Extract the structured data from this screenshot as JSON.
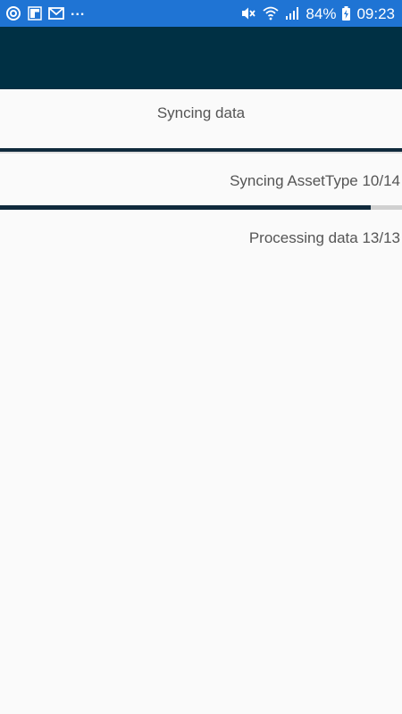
{
  "status_bar": {
    "icons_left": [
      "sync-circle-icon",
      "flipboard-icon",
      "gmail-icon"
    ],
    "more_notifications": "...",
    "icons_right": [
      "mute-icon",
      "wifi-icon",
      "signal-icon"
    ],
    "battery_percent": "84%",
    "time": "09:23",
    "background": "#1f74d4"
  },
  "app_bar": {
    "background": "#003044"
  },
  "sync": {
    "title": "Syncing data",
    "overall_progress": 1.0,
    "asset_label": "Syncing AssetType 10/14",
    "asset_progress": 0.9222,
    "processing_label": "Processing data 13/13",
    "progress_color": "#102a3c",
    "track_color": "#d0d0d0"
  }
}
